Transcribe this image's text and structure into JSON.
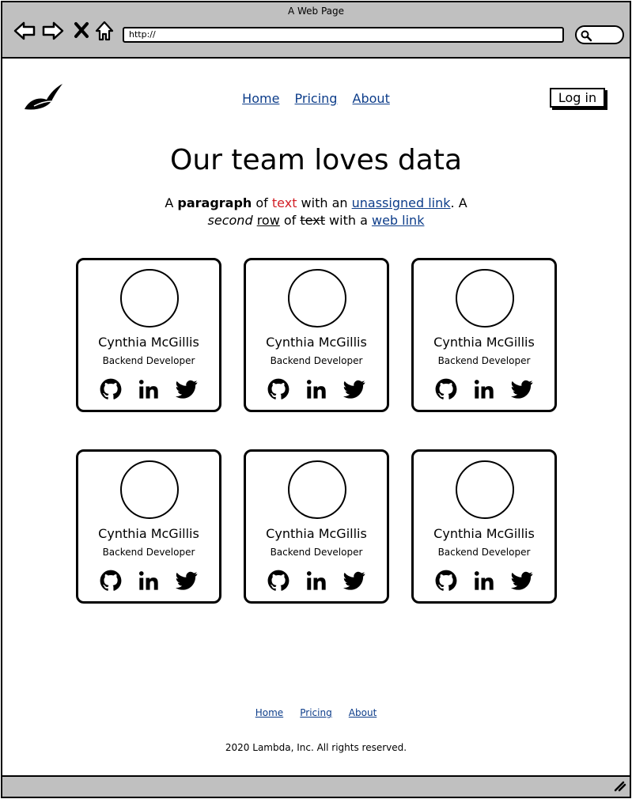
{
  "window": {
    "title": "A Web Page"
  },
  "browser": {
    "address": "http://",
    "icons": [
      "back-arrow-icon",
      "forward-arrow-icon",
      "stop-icon",
      "home-icon",
      "search-icon"
    ]
  },
  "header": {
    "logo_icon": "feather-logo-icon",
    "nav": [
      {
        "label": "Home"
      },
      {
        "label": "Pricing"
      },
      {
        "label": "About"
      }
    ],
    "login_label": "Log in"
  },
  "hero": {
    "title": "Our team loves data",
    "p_a": "A ",
    "p_bold": "paragraph",
    "p_of": " of ",
    "p_red": "text",
    "p_with": " with an ",
    "p_link1": "unassigned link",
    "p_dotA": ". A",
    "p_second": "second",
    "p_row": "row",
    "p_of2": " of ",
    "p_text2": "text",
    "p_with2": " with a ",
    "p_link2": "web link"
  },
  "team": [
    {
      "name": "Cynthia McGillis",
      "role": "Backend Developer"
    },
    {
      "name": "Cynthia McGillis",
      "role": "Backend Developer"
    },
    {
      "name": "Cynthia McGillis",
      "role": "Backend Developer"
    },
    {
      "name": "Cynthia McGillis",
      "role": "Backend Developer"
    },
    {
      "name": "Cynthia McGillis",
      "role": "Backend Developer"
    },
    {
      "name": "Cynthia McGillis",
      "role": "Backend Developer"
    }
  ],
  "social_icons": [
    "github-icon",
    "linkedin-icon",
    "twitter-icon"
  ],
  "footer": {
    "nav": [
      {
        "label": "Home"
      },
      {
        "label": "Pricing"
      },
      {
        "label": "About"
      }
    ],
    "copyright": "2020 Lambda, Inc. All rights reserved."
  },
  "colors": {
    "chrome": "#c0c0c0",
    "link": "#0d3d8a",
    "red": "#d21f26"
  }
}
